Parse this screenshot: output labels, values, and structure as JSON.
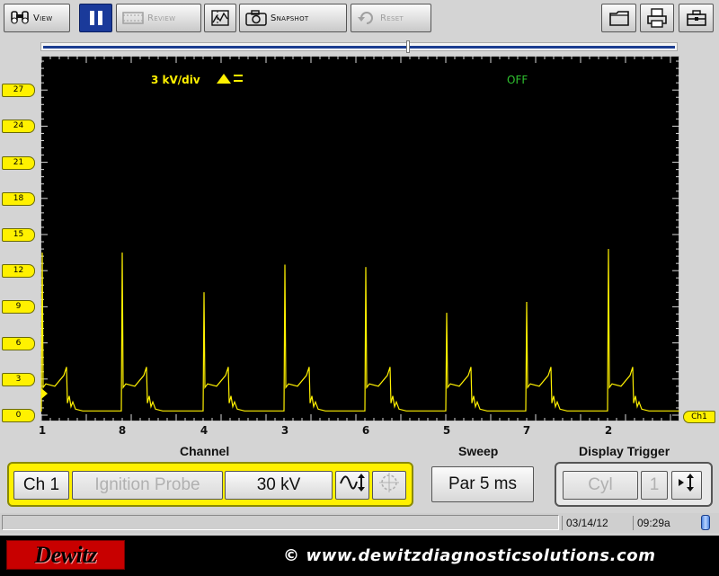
{
  "toolbar": {
    "view_label": "View",
    "review_label": "Review",
    "snapshot_label": "Snapshot",
    "reset_label": "Reset"
  },
  "scope": {
    "scale_label": "3 kV/div",
    "trigger_status": "OFF",
    "channel_tag": "Ch1",
    "trace_color": "#fff100"
  },
  "chart_data": {
    "type": "line",
    "title": "",
    "xlabel": "Channel",
    "ylabel": "",
    "ylim": [
      0,
      30
    ],
    "yticks": [
      "0",
      "3",
      "6",
      "9",
      "12",
      "15",
      "18",
      "21",
      "24",
      "27"
    ],
    "x_categories": [
      "1",
      "8",
      "4",
      "3",
      "6",
      "5",
      "7",
      "2"
    ],
    "series": [
      {
        "values": [
          13.5,
          13.5,
          10.2,
          12.5,
          12.3,
          8.5,
          9.4,
          13.8
        ]
      }
    ]
  },
  "labels": {
    "channel": "Channel",
    "sweep": "Sweep",
    "display_trigger": "Display Trigger"
  },
  "controls": {
    "channel": "Ch 1",
    "probe": "Ignition Probe",
    "scale": "30 kV",
    "sweep": "Par 5 ms",
    "trigger_source": "Cyl",
    "trigger_number": "1"
  },
  "status": {
    "date": "03/14/12",
    "time": "09:29a"
  },
  "footer": {
    "logo": "Dewitz",
    "copyright": "© www.dewitzdiagnosticsolutions.com"
  }
}
